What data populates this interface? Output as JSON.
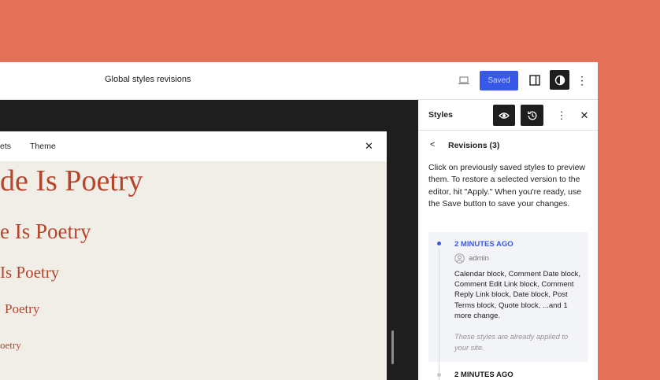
{
  "topbar": {
    "title": "Global styles revisions",
    "saved_label": "Saved",
    "more_glyph": "⋮"
  },
  "preview": {
    "tabs": [
      "ets",
      "Theme"
    ],
    "close_glyph": "✕",
    "headings": [
      "de Is Poetry",
      "e Is Poetry",
      "Is Poetry",
      "Poetry",
      "oetry"
    ]
  },
  "sidebar": {
    "title": "Styles",
    "more_glyph": "⋮",
    "close_glyph": "✕",
    "revisions": {
      "back_glyph": "<",
      "title": "Revisions (3)",
      "description": "Click on previously saved styles to preview them. To restore a selected version to the editor, hit \"Apply.\" When you're ready, use the Save button to save your changes.",
      "items": [
        {
          "time": "2 MINUTES AGO",
          "author": "admin",
          "changes": "Calendar block, Comment Date block, Comment Edit Link block, Comment Reply Link block, Date block, Post Terms block, Quote block, ...and 1 more change.",
          "note": "These styles are already applied to your site."
        },
        {
          "time": "2 MINUTES AGO"
        }
      ]
    }
  },
  "colors": {
    "background": "#e5705a",
    "accent": "#3858e9",
    "heading": "#b5452b"
  },
  "icons": [
    "laptop-icon",
    "sidebar-panel-icon",
    "half-circle-icon",
    "eye-icon",
    "history-icon",
    "user-avatar-icon",
    "chevron-left-icon"
  ]
}
